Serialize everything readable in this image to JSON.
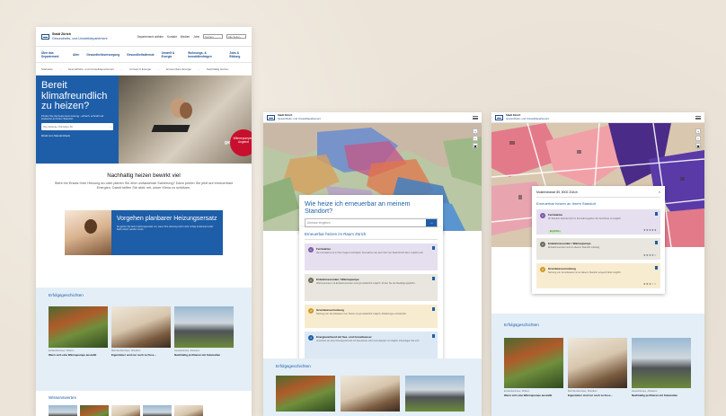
{
  "left": {
    "logo": {
      "line1": "Stadt Zürich",
      "line2": "Gesundheits- und Umweltdepartement"
    },
    "top_links": [
      "Departement wählen",
      "Kontakt",
      "Medien",
      "Jobs"
    ],
    "top_search_placeholder": "Suchen",
    "top_site_search": "Alle Seiten",
    "nav": [
      "Über das Departement",
      "Alter",
      "Gesundheitsversorgung",
      "Gesundheitsdienste",
      "Umwelt & Energie",
      "Wohnungs- & Immobilienfragen",
      "Jobs & Bildung"
    ],
    "breadcrumb": [
      "Startseite",
      "Gesundheits- und Umweltdepartement",
      "Umwelt & Energie",
      "Erneuerbare Energie",
      "Nachhaltig Heizen"
    ],
    "hero": {
      "title": "Bereit klimafreundlich zu heizen?",
      "subtitle": "Finden Sie die beste Heiz-Lösung - einfach, schnell und kostenlos an Ihrem Standort.",
      "search_placeholder": "Ihre Adresse, Parzellen-Nr.",
      "search_arrow": "→",
      "link": "Direkt zum Standortcheck",
      "credit": "getty",
      "badge": "Wärmepumpen-Angebot"
    },
    "intro": {
      "title": "Nachhaltig heizen bewirkt viel",
      "text": "Steht ein Ersatz Ihrer Heizung an oder planen Sie eine umfassende Sanierung? Dann prüfen Sie jetzt auf erneuerbare Energien. Damit helfen Sie aktiv mit, unser Klima zu schützen."
    },
    "promo": {
      "title": "Vorgehen planbarer Heizungsersatz",
      "desc": "So gehen Sie beim Heizungsersatz vor, wenn Ihre Heizung nicht mehr richtig funktioniert oder bald ersetzt werden muss."
    },
    "stories_title": "Erfolgsgeschichten",
    "stories": [
      {
        "cap": "Einfamilienhaus, Witikon",
        "title": "Wenn sich eine Wärmepumpe auszahlt"
      },
      {
        "cap": "Mehrfamilienhaus, Wiedikon",
        "title": "Eigentümer sind nur noch zu Fuss..."
      },
      {
        "cap": "Gewerbehaus, Altstetten",
        "title": "Nachhaltig profitieren mit Solarzellen"
      }
    ],
    "knowledge_title": "Wissenswertes"
  },
  "middle": {
    "logo": {
      "line1": "Stadt Zürich",
      "line2": "Gesundheits- und Umweltdepartement"
    },
    "question": "Wie heize ich erneuerbar an meinem Standort?",
    "search_placeholder": "Adresse eingeben",
    "search_arrow": "→",
    "results_title": "Erneuerbar heizen im Raum Zürich",
    "options": [
      {
        "num": "1",
        "title": "Fernwärme",
        "desc": "Die Fernwärme ist in Ihrer Gegend verfügbar. Fernwärme aus dem Netz der Stadt Zürich kann möglich sein."
      },
      {
        "num": "2",
        "title": "Erdwärmesonden / Wärmepumpe",
        "desc": "Wärmepumpen mit Erdwärmesonden sind grundsätzlich möglich. Prüfen Sie die Bewilligungspflicht."
      },
      {
        "num": "3",
        "title": "Grundwassernutzung",
        "desc": "Nutzung von Grundwasser zum Heizen ist grundsätzlich möglich. Abklärungen erforderlich."
      },
      {
        "num": "4",
        "title": "Energieverbund mit See- und Grundwasser",
        "desc": "Anschluss an einen Energieverbund mit Seewasser oder Grundwasser ist möglich. Erkundigen Sie sich."
      }
    ],
    "stories_title": "Erfolgsgeschichten"
  },
  "right": {
    "logo": {
      "line1": "Stadt Zürich",
      "line2": "Gesundheits- und Umweltdepartement"
    },
    "address": "Musterstrasse 85, 8002 Zürich",
    "close": "×",
    "subtitle": "Erneuerbar heizen an Ihrem Standort",
    "options": [
      {
        "num": "1",
        "title": "Fernwärme",
        "desc": "Ihr Standort befindet sich im Fernwärmegebiet. Ein Anschluss ist möglich.",
        "tag": "Empfohlen",
        "stars": "★★★★★"
      },
      {
        "num": "2",
        "title": "Erdwärmesonden / Wärmepumpe",
        "desc": "Erdwärmesonden sind an diesem Standort zulässig.",
        "stars": "★★★★☆"
      },
      {
        "num": "3",
        "title": "Grundwassernutzung",
        "desc": "Nutzung von Grundwasser ist an diesem Standort eingeschränkt möglich.",
        "stars": "★★★☆☆"
      }
    ],
    "stories_title": "Erfolgsgeschichten",
    "stories": [
      {
        "cap": "Einfamilienhaus, Witikon",
        "title": "Wenn sich eine Wärmepumpe auszahlt"
      },
      {
        "cap": "Mehrfamilienhaus, Wiedikon",
        "title": "Eigentümer sind nur noch zu Fuss..."
      },
      {
        "cap": "Gewerbehaus, Altstetten",
        "title": "Nachhaltig profitieren mit Solarzellen"
      }
    ]
  },
  "icons": {
    "menu": "hamburger-icon",
    "zoom_in": "+",
    "zoom_out": "−",
    "layers": "▣"
  },
  "colors": {
    "brand": "#1e5ea8",
    "hero_bg": "#1e5ea8",
    "badge": "#c8102e",
    "stories_bg": "#e3eef7"
  }
}
